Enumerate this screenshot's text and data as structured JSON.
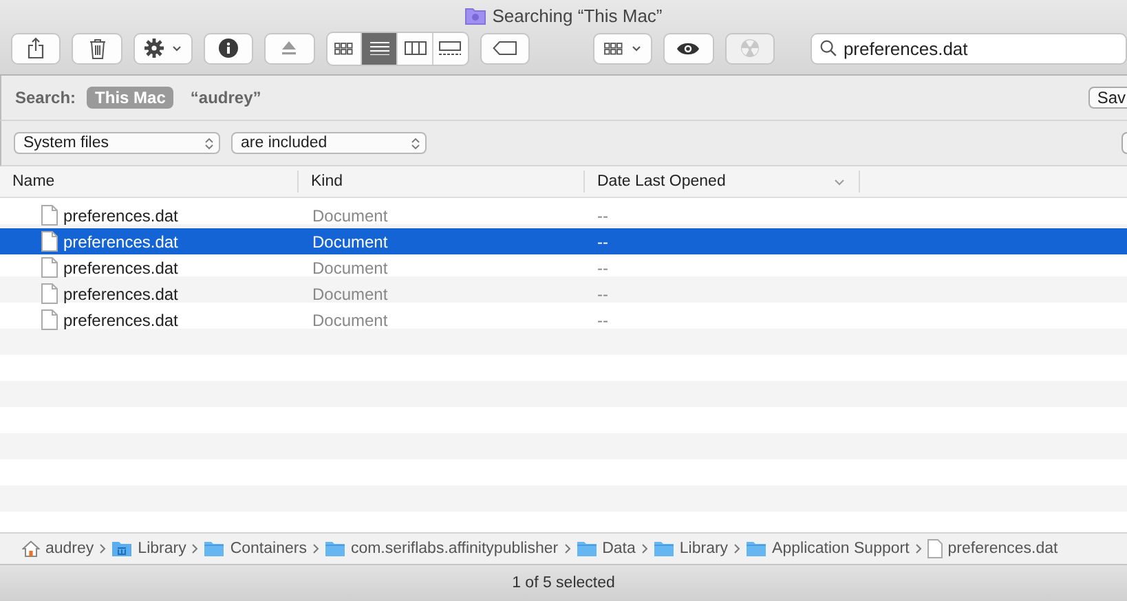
{
  "window": {
    "title": "Searching “This Mac”"
  },
  "toolbar": {
    "items": [
      {
        "kind": "share"
      },
      {
        "kind": "trash"
      },
      {
        "kind": "gear-menu"
      },
      {
        "kind": "info"
      },
      {
        "kind": "eject"
      },
      {
        "kind": "view-switch",
        "views": [
          {
            "kind": "icons",
            "selected": false
          },
          {
            "kind": "list",
            "selected": true
          },
          {
            "kind": "columns",
            "selected": false
          },
          {
            "kind": "gallery",
            "selected": false
          }
        ]
      },
      {
        "kind": "tag"
      },
      {
        "kind": "group-menu"
      },
      {
        "kind": "eye"
      },
      {
        "kind": "burn",
        "disabled": true
      }
    ]
  },
  "search": {
    "value": "preferences.dat"
  },
  "scope_bar": {
    "label": "Search:",
    "scopes": [
      {
        "label": "This Mac",
        "selected": true
      },
      {
        "label": "“audrey”",
        "selected": false
      }
    ],
    "save_button": "Sav"
  },
  "criteria": [
    {
      "attribute": "System files",
      "operator": "are included"
    }
  ],
  "table": {
    "columns": [
      {
        "label": "Name",
        "sorted": false
      },
      {
        "label": "Kind",
        "sorted": false
      },
      {
        "label": "Date Last Opened",
        "sorted": true
      }
    ],
    "rows": [
      {
        "name": "preferences.dat",
        "kind": "Document",
        "date": "--",
        "selected": false
      },
      {
        "name": "preferences.dat",
        "kind": "Document",
        "date": "--",
        "selected": true
      },
      {
        "name": "preferences.dat",
        "kind": "Document",
        "date": "--",
        "selected": false
      },
      {
        "name": "preferences.dat",
        "kind": "Document",
        "date": "--",
        "selected": false
      },
      {
        "name": "preferences.dat",
        "kind": "Document",
        "date": "--",
        "selected": false
      }
    ]
  },
  "path_bar": [
    {
      "label": "audrey",
      "kind": "home"
    },
    {
      "label": "Library",
      "kind": "library"
    },
    {
      "label": "Containers",
      "kind": "folder"
    },
    {
      "label": "com.seriflabs.affinitypublisher",
      "kind": "folder"
    },
    {
      "label": "Data",
      "kind": "folder"
    },
    {
      "label": "Library",
      "kind": "folder"
    },
    {
      "label": "Application Support",
      "kind": "folder"
    },
    {
      "label": "preferences.dat",
      "kind": "file"
    }
  ],
  "status_bar": "1 of 5 selected"
}
